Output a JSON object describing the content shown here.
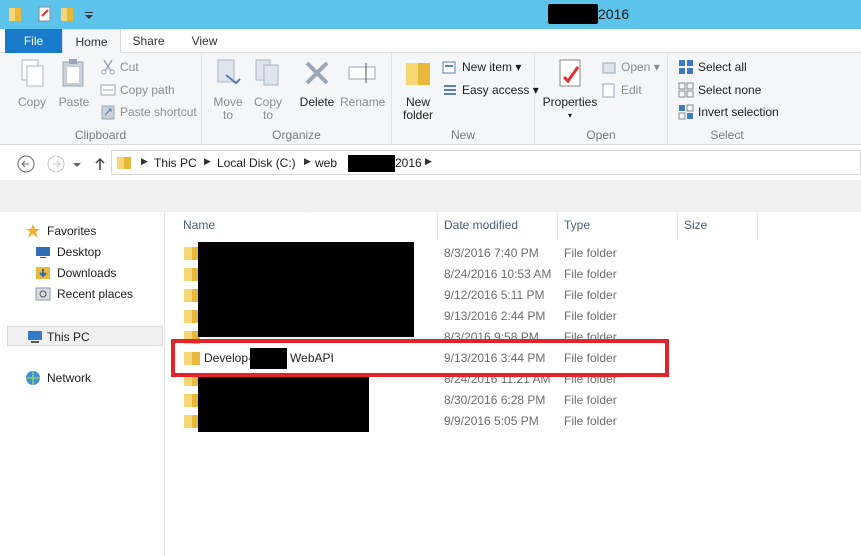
{
  "window": {
    "title_suffix": "2016"
  },
  "tabs": [
    {
      "label": "File"
    },
    {
      "label": "Home"
    },
    {
      "label": "Share"
    },
    {
      "label": "View"
    }
  ],
  "ribbon": {
    "clipboard": {
      "label": "Clipboard",
      "copy": "Copy",
      "paste": "Paste",
      "cut": "Cut",
      "copy_path": "Copy path",
      "paste_shortcut": "Paste shortcut"
    },
    "organize": {
      "label": "Organize",
      "move_to_1": "Move",
      "move_to_2": "to",
      "copy_to_1": "Copy",
      "copy_to_2": "to",
      "delete": "Delete",
      "rename": "Rename"
    },
    "new": {
      "label": "New",
      "new_folder_1": "New",
      "new_folder_2": "folder",
      "new_item": "New item",
      "easy_access": "Easy access"
    },
    "open": {
      "label": "Open",
      "properties": "Properties",
      "open": "Open",
      "edit": "Edit"
    },
    "select": {
      "label": "Select",
      "select_all": "Select all",
      "select_none": "Select none",
      "invert": "Invert selection"
    }
  },
  "address": {
    "crumbs": [
      "This PC",
      "Local Disk (C:)",
      "web",
      "2016"
    ]
  },
  "navigation": {
    "favorites": "Favorites",
    "desktop": "Desktop",
    "downloads": "Downloads",
    "recent": "Recent places",
    "this_pc": "This PC",
    "network": "Network"
  },
  "columns": {
    "name": "Name",
    "date": "Date modified",
    "type": "Type",
    "size": "Size"
  },
  "files": [
    {
      "name": "",
      "date": "8/3/2016 7:40 PM",
      "type": "File folder"
    },
    {
      "name": "",
      "date": "8/24/2016 10:53 AM",
      "type": "File folder"
    },
    {
      "name": "",
      "date": "9/12/2016 5:11 PM",
      "type": "File folder"
    },
    {
      "name": "",
      "date": "9/13/2016 2:44 PM",
      "type": "File folder"
    },
    {
      "name": "",
      "date": "8/3/2016 9:58 PM",
      "type": "File folder"
    },
    {
      "name_prefix": "Develop-",
      "name_suffix": "WebAPI",
      "date": "9/13/2016 3:44 PM",
      "type": "File folder"
    },
    {
      "name": "",
      "date": "8/24/2016 11:21 AM",
      "type": "File folder"
    },
    {
      "name": "",
      "date": "8/30/2016 6:28 PM",
      "type": "File folder"
    },
    {
      "name": "",
      "date": "9/9/2016 5:05 PM",
      "type": "File folder"
    }
  ],
  "colors": {
    "titlebar": "#5dc3ea",
    "file_tab": "#1979ca",
    "highlight": "#e3222a"
  }
}
